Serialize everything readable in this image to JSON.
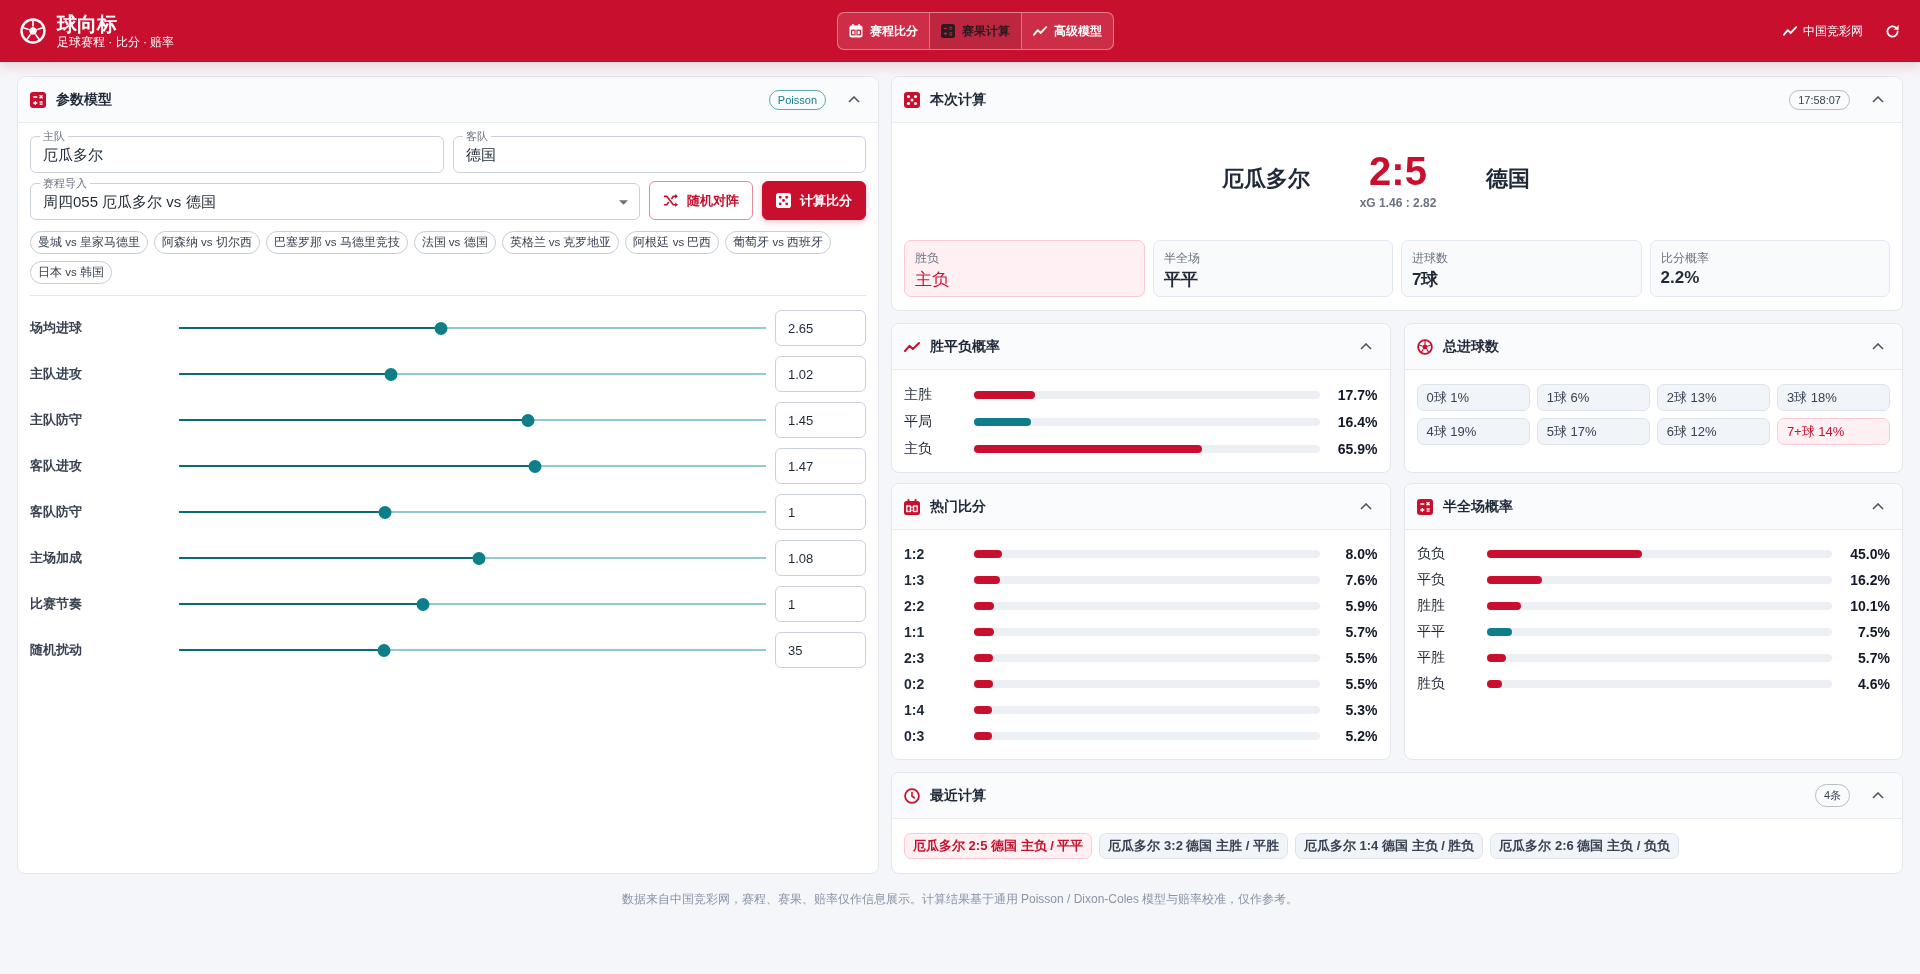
{
  "header": {
    "title": "球向标",
    "subtitle": "足球赛程 · 比分 · 赔率",
    "nav": [
      {
        "label": "赛程比分",
        "selected": false
      },
      {
        "label": "赛果计算",
        "selected": true
      },
      {
        "label": "高级模型",
        "selected": false
      }
    ],
    "link": "中国竞彩网"
  },
  "params": {
    "title": "参数模型",
    "badge": "Poisson",
    "expanded": true,
    "home": {
      "label": "主队",
      "value": "厄瓜多尔"
    },
    "away": {
      "label": "客队",
      "value": "德国"
    },
    "fixture": {
      "label": "赛程导入",
      "value": "周四055 厄瓜多尔 vs 德国"
    },
    "buttons": [
      {
        "label": "随机对阵",
        "kind": "outline"
      },
      {
        "label": "计算比分",
        "kind": "primary"
      }
    ],
    "presets": [
      "曼城 vs 皇家马德里",
      "阿森纳 vs 切尔西",
      "巴塞罗那 vs 马德里竞技",
      "法国 vs 德国",
      "英格兰 vs 克罗地亚",
      "阿根廷 vs 巴西",
      "葡萄牙 vs 西班牙",
      "日本 vs 韩国"
    ],
    "sliders": [
      {
        "label": "场均进球",
        "level": 0.447,
        "value": "2.65"
      },
      {
        "label": "主队进攻",
        "level": 0.362,
        "value": "1.02"
      },
      {
        "label": "主队防守",
        "level": 0.594,
        "value": "1.45"
      },
      {
        "label": "客队进攻",
        "level": 0.606,
        "value": "1.47"
      },
      {
        "label": "客队防守",
        "level": 0.351,
        "value": "1"
      },
      {
        "label": "主场加成",
        "level": 0.511,
        "value": "1.08"
      },
      {
        "label": "比赛节奏",
        "level": 0.416,
        "value": "1"
      },
      {
        "label": "随机扰动",
        "level": 0.349,
        "value": "35"
      }
    ]
  },
  "result": {
    "title": "本次计算",
    "time": "17:58:07",
    "expanded": true,
    "home": "厄瓜多尔",
    "score": "2:5",
    "away": "德国",
    "xg": "xG 1.46 : 2.82",
    "stats": [
      {
        "label": "胜负",
        "value": "主负",
        "selected": true
      },
      {
        "label": "半全场",
        "value": "平平",
        "selected": false
      },
      {
        "label": "进球数",
        "value": "7球",
        "selected": false
      },
      {
        "label": "比分概率",
        "value": "2.2%",
        "selected": false
      }
    ]
  },
  "outcome": {
    "title": "胜平负概率",
    "expanded": true,
    "rows": [
      {
        "label": "主胜",
        "level": 0.177,
        "value": "17.7%",
        "color": "#c8102e"
      },
      {
        "label": "平局",
        "level": 0.164,
        "value": "16.4%",
        "color": "#0e7f88"
      },
      {
        "label": "主负",
        "level": 0.659,
        "value": "65.9%",
        "color": "#c8102e"
      }
    ]
  },
  "goals": {
    "title": "总进球数",
    "expanded": true,
    "items": [
      {
        "label": "0球 1%",
        "selected": false
      },
      {
        "label": "1球 6%",
        "selected": false
      },
      {
        "label": "2球 13%",
        "selected": false
      },
      {
        "label": "3球 18%",
        "selected": false
      },
      {
        "label": "4球 19%",
        "selected": false
      },
      {
        "label": "5球 17%",
        "selected": false
      },
      {
        "label": "6球 12%",
        "selected": false
      },
      {
        "label": "7+球 14%",
        "selected": true
      }
    ]
  },
  "hot_scores": {
    "title": "热门比分",
    "expanded": true,
    "rows": [
      {
        "label": "1:2",
        "level": 0.08,
        "value": "8.0%",
        "color": "#c8102e"
      },
      {
        "label": "1:3",
        "level": 0.076,
        "value": "7.6%",
        "color": "#c8102e"
      },
      {
        "label": "2:2",
        "level": 0.059,
        "value": "5.9%",
        "color": "#c8102e"
      },
      {
        "label": "1:1",
        "level": 0.057,
        "value": "5.7%",
        "color": "#c8102e"
      },
      {
        "label": "2:3",
        "level": 0.055,
        "value": "5.5%",
        "color": "#c8102e"
      },
      {
        "label": "0:2",
        "level": 0.055,
        "value": "5.5%",
        "color": "#c8102e"
      },
      {
        "label": "1:4",
        "level": 0.053,
        "value": "5.3%",
        "color": "#c8102e"
      },
      {
        "label": "0:3",
        "level": 0.052,
        "value": "5.2%",
        "color": "#c8102e"
      }
    ]
  },
  "halftime": {
    "title": "半全场概率",
    "expanded": true,
    "rows": [
      {
        "label": "负负",
        "level": 0.45,
        "value": "45.0%",
        "color": "#c8102e"
      },
      {
        "label": "平负",
        "level": 0.162,
        "value": "16.2%",
        "color": "#c8102e"
      },
      {
        "label": "胜胜",
        "level": 0.101,
        "value": "10.1%",
        "color": "#c8102e"
      },
      {
        "label": "平平",
        "level": 0.075,
        "value": "7.5%",
        "color": "#0e7f88"
      },
      {
        "label": "平胜",
        "level": 0.057,
        "value": "5.7%",
        "color": "#c8102e"
      },
      {
        "label": "胜负",
        "level": 0.046,
        "value": "4.6%",
        "color": "#c8102e"
      }
    ]
  },
  "recent": {
    "title": "最近计算",
    "count": "4条",
    "expanded": true,
    "items": [
      {
        "label": "厄瓜多尔 2:5 德国 主负 / 平平",
        "selected": true
      },
      {
        "label": "厄瓜多尔 3:2 德国 主胜 / 平胜",
        "selected": false
      },
      {
        "label": "厄瓜多尔 1:4 德国 主负 / 胜负",
        "selected": false
      },
      {
        "label": "厄瓜多尔 2:6 德国 主负 / 负负",
        "selected": false
      }
    ]
  },
  "footer": "数据来自中国竞彩网，赛程、赛果、赔率仅作信息展示。计算结果基于通用 Poisson / Dixon-Coles 模型与赔率校准，仅作参考。"
}
